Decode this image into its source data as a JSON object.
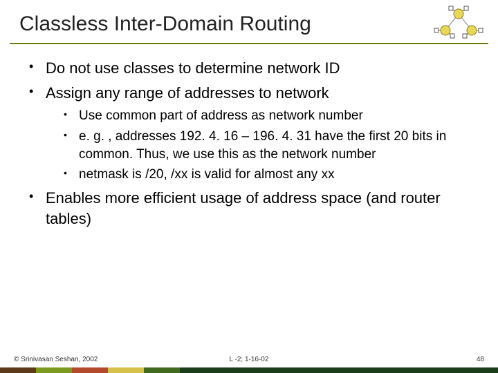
{
  "title": "Classless Inter-Domain Routing",
  "bullets": {
    "b1": "Do not use classes to determine network ID",
    "b2": "Assign any range of addresses to network",
    "b2s1": "Use common part of address as network number",
    "b2s2": "e. g. , addresses 192. 4. 16 – 196. 4. 31 have the first 20 bits in common. Thus, we use this as the network number",
    "b2s3": "netmask is /20, /xx is valid for almost any xx",
    "b3": "Enables more efficient usage of address space (and router tables)"
  },
  "footer": {
    "left": "© Srinivasan Seshan, 2002",
    "mid": "L -2; 1-16-02",
    "right": "48"
  },
  "logo_name": "network-topology-icon"
}
